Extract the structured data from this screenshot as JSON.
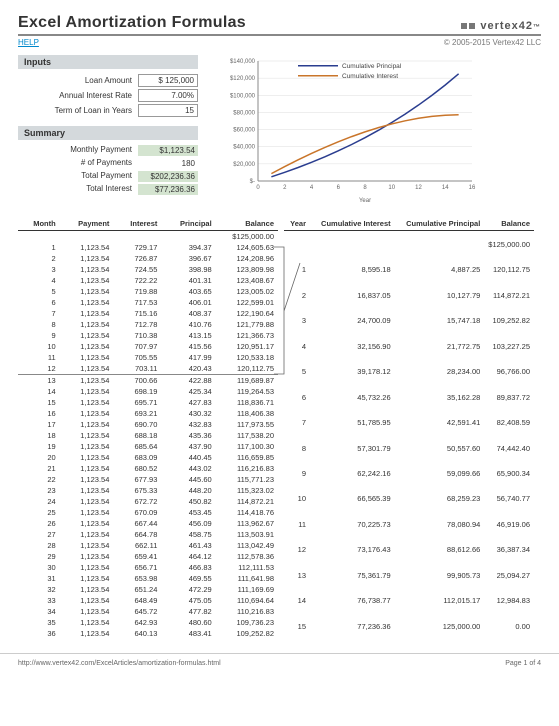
{
  "header": {
    "title": "Excel Amortization Formulas",
    "logo": "vertex42",
    "help": "HELP",
    "copyright": "© 2005-2015 Vertex42 LLC"
  },
  "sections": {
    "inputs": "Inputs",
    "summary": "Summary"
  },
  "inputs": {
    "loan_amount_label": "Loan Amount",
    "loan_amount": "$   125,000",
    "rate_label": "Annual Interest Rate",
    "rate": "7.00%",
    "term_label": "Term of Loan in Years",
    "term": "15"
  },
  "summary": {
    "monthly_label": "Monthly Payment",
    "monthly": "$1,123.54",
    "npmts_label": "# of Payments",
    "npmts": "180",
    "total_label": "Total Payment",
    "total": "$202,236.36",
    "int_label": "Total Interest",
    "int": "$77,236.36"
  },
  "chart_data": {
    "type": "line",
    "xlabel": "Year",
    "ylim": [
      0,
      140000
    ],
    "xlim": [
      0,
      16
    ],
    "yticks": [
      "$-",
      "$20,000",
      "$40,000",
      "$60,000",
      "$80,000",
      "$100,000",
      "$120,000",
      "$140,000"
    ],
    "xticks": [
      "0",
      "2",
      "4",
      "6",
      "8",
      "10",
      "12",
      "14",
      "16"
    ],
    "series": [
      {
        "name": "Cumulative Principal",
        "color": "#2a3d8f",
        "x": [
          1,
          2,
          3,
          4,
          5,
          6,
          7,
          8,
          9,
          10,
          11,
          12,
          13,
          14,
          15
        ],
        "y": [
          4887.25,
          10127.79,
          15747.18,
          21772.75,
          28234.0,
          35162.28,
          42591.41,
          50557.6,
          59099.66,
          68259.23,
          78080.94,
          88612.66,
          99905.73,
          112015.17,
          125000.0
        ]
      },
      {
        "name": "Cumulative Interest",
        "color": "#c9752a",
        "x": [
          1,
          2,
          3,
          4,
          5,
          6,
          7,
          8,
          9,
          10,
          11,
          12,
          13,
          14,
          15
        ],
        "y": [
          8595.18,
          16837.05,
          24700.09,
          32156.9,
          39178.12,
          45732.26,
          51785.95,
          57301.79,
          62242.16,
          66565.39,
          70225.73,
          73176.43,
          75361.79,
          76738.77,
          77236.36
        ]
      }
    ]
  },
  "tbl1": {
    "headers": [
      "Month",
      "Payment",
      "Interest",
      "Principal",
      "Balance"
    ],
    "start_balance": "$125,000.00",
    "rows": [
      [
        "1",
        "1,123.54",
        "729.17",
        "394.37",
        "124,605.63"
      ],
      [
        "2",
        "1,123.54",
        "726.87",
        "396.67",
        "124,208.96"
      ],
      [
        "3",
        "1,123.54",
        "724.55",
        "398.98",
        "123,809.98"
      ],
      [
        "4",
        "1,123.54",
        "722.22",
        "401.31",
        "123,408.67"
      ],
      [
        "5",
        "1,123.54",
        "719.88",
        "403.65",
        "123,005.02"
      ],
      [
        "6",
        "1,123.54",
        "717.53",
        "406.01",
        "122,599.01"
      ],
      [
        "7",
        "1,123.54",
        "715.16",
        "408.37",
        "122,190.64"
      ],
      [
        "8",
        "1,123.54",
        "712.78",
        "410.76",
        "121,779.88"
      ],
      [
        "9",
        "1,123.54",
        "710.38",
        "413.15",
        "121,366.73"
      ],
      [
        "10",
        "1,123.54",
        "707.97",
        "415.56",
        "120,951.17"
      ],
      [
        "11",
        "1,123.54",
        "705.55",
        "417.99",
        "120,533.18"
      ],
      [
        "12",
        "1,123.54",
        "703.11",
        "420.43",
        "120,112.75"
      ],
      [
        "13",
        "1,123.54",
        "700.66",
        "422.88",
        "119,689.87"
      ],
      [
        "14",
        "1,123.54",
        "698.19",
        "425.34",
        "119,264.53"
      ],
      [
        "15",
        "1,123.54",
        "695.71",
        "427.83",
        "118,836.71"
      ],
      [
        "16",
        "1,123.54",
        "693.21",
        "430.32",
        "118,406.38"
      ],
      [
        "17",
        "1,123.54",
        "690.70",
        "432.83",
        "117,973.55"
      ],
      [
        "18",
        "1,123.54",
        "688.18",
        "435.36",
        "117,538.20"
      ],
      [
        "19",
        "1,123.54",
        "685.64",
        "437.90",
        "117,100.30"
      ],
      [
        "20",
        "1,123.54",
        "683.09",
        "440.45",
        "116,659.85"
      ],
      [
        "21",
        "1,123.54",
        "680.52",
        "443.02",
        "116,216.83"
      ],
      [
        "22",
        "1,123.54",
        "677.93",
        "445.60",
        "115,771.23"
      ],
      [
        "23",
        "1,123.54",
        "675.33",
        "448.20",
        "115,323.02"
      ],
      [
        "24",
        "1,123.54",
        "672.72",
        "450.82",
        "114,872.21"
      ],
      [
        "25",
        "1,123.54",
        "670.09",
        "453.45",
        "114,418.76"
      ],
      [
        "26",
        "1,123.54",
        "667.44",
        "456.09",
        "113,962.67"
      ],
      [
        "27",
        "1,123.54",
        "664.78",
        "458.75",
        "113,503.91"
      ],
      [
        "28",
        "1,123.54",
        "662.11",
        "461.43",
        "113,042.49"
      ],
      [
        "29",
        "1,123.54",
        "659.41",
        "464.12",
        "112,578.36"
      ],
      [
        "30",
        "1,123.54",
        "656.71",
        "466.83",
        "112,111.53"
      ],
      [
        "31",
        "1,123.54",
        "653.98",
        "469.55",
        "111,641.98"
      ],
      [
        "32",
        "1,123.54",
        "651.24",
        "472.29",
        "111,169.69"
      ],
      [
        "33",
        "1,123.54",
        "648.49",
        "475.05",
        "110,694.64"
      ],
      [
        "34",
        "1,123.54",
        "645.72",
        "477.82",
        "110,216.83"
      ],
      [
        "35",
        "1,123.54",
        "642.93",
        "480.60",
        "109,736.23"
      ],
      [
        "36",
        "1,123.54",
        "640.13",
        "483.41",
        "109,252.82"
      ]
    ]
  },
  "tbl2": {
    "headers": [
      "Year",
      "Cumulative Interest",
      "Cumulative Principal",
      "Balance"
    ],
    "start_balance": "$125,000.00",
    "rows": [
      [
        "1",
        "8,595.18",
        "4,887.25",
        "120,112.75"
      ],
      [
        "2",
        "16,837.05",
        "10,127.79",
        "114,872.21"
      ],
      [
        "3",
        "24,700.09",
        "15,747.18",
        "109,252.82"
      ],
      [
        "4",
        "32,156.90",
        "21,772.75",
        "103,227.25"
      ],
      [
        "5",
        "39,178.12",
        "28,234.00",
        "96,766.00"
      ],
      [
        "6",
        "45,732.26",
        "35,162.28",
        "89,837.72"
      ],
      [
        "7",
        "51,785.95",
        "42,591.41",
        "82,408.59"
      ],
      [
        "8",
        "57,301.79",
        "50,557.60",
        "74,442.40"
      ],
      [
        "9",
        "62,242.16",
        "59,099.66",
        "65,900.34"
      ],
      [
        "10",
        "66,565.39",
        "68,259.23",
        "56,740.77"
      ],
      [
        "11",
        "70,225.73",
        "78,080.94",
        "46,919.06"
      ],
      [
        "12",
        "73,176.43",
        "88,612.66",
        "36,387.34"
      ],
      [
        "13",
        "75,361.79",
        "99,905.73",
        "25,094.27"
      ],
      [
        "14",
        "76,738.77",
        "112,015.17",
        "12,984.83"
      ],
      [
        "15",
        "77,236.36",
        "125,000.00",
        "0.00"
      ]
    ]
  },
  "footer": {
    "url": "http://www.vertex42.com/ExcelArticles/amortization-formulas.html",
    "page": "Page 1 of 4"
  }
}
